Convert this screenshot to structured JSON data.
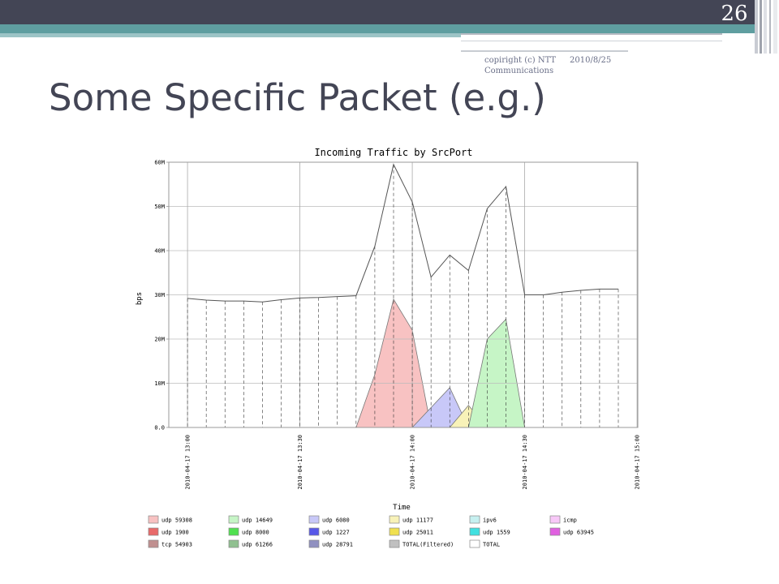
{
  "slide": {
    "number": "26",
    "title": "Some Specific Packet (e.g.)",
    "footer_left_1": "copiright (c) NTT",
    "footer_left_2": "Communications",
    "footer_right": "2010/8/25"
  },
  "colors": {
    "header": "#434555",
    "accent": "#5f9ea0"
  },
  "chart_data": {
    "type": "area",
    "title": "Incoming Traffic by SrcPort",
    "xlabel": "Time",
    "ylabel": "bps",
    "ylim": [
      0,
      60
    ],
    "xlim": [
      0,
      120
    ],
    "y_ticks": [
      {
        "v": 0,
        "label": "0.0"
      },
      {
        "v": 10,
        "label": "10M"
      },
      {
        "v": 20,
        "label": "20M"
      },
      {
        "v": 30,
        "label": "30M"
      },
      {
        "v": 40,
        "label": "40M"
      },
      {
        "v": 50,
        "label": "50M"
      },
      {
        "v": 60,
        "label": "60M"
      }
    ],
    "x_ticks": [
      {
        "v": 5,
        "label": "2010-04-17 13:00"
      },
      {
        "v": 35,
        "label": "2010-04-17 13:30"
      },
      {
        "v": 65,
        "label": "2010-04-17 14:00"
      },
      {
        "v": 95,
        "label": "2010-04-17 14:30"
      },
      {
        "v": 125,
        "label": "2010-04-17 15:00"
      }
    ],
    "sample_x": [
      5,
      10,
      15,
      20,
      25,
      30,
      35,
      40,
      45,
      50,
      55,
      60,
      65,
      70,
      75,
      80,
      85,
      90,
      95,
      100,
      105,
      110,
      115,
      120
    ],
    "total": [
      29.2,
      28.8,
      28.6,
      28.6,
      28.4,
      28.9,
      29.3,
      29.4,
      29.6,
      29.8,
      41,
      59.5,
      51,
      34,
      39,
      35.5,
      49.5,
      54.5,
      30,
      30,
      30.6,
      31,
      31.3,
      31.3
    ],
    "series": [
      {
        "name": "udp 59308",
        "color": "#f8c2c2",
        "x": [
          50,
          55,
          60,
          65,
          70
        ],
        "y": [
          0,
          12,
          29,
          22,
          0
        ]
      },
      {
        "name": "udp 1227",
        "color": "#c8c8f8",
        "x": [
          65,
          70,
          75,
          80
        ],
        "y": [
          0,
          4.5,
          9,
          0
        ]
      },
      {
        "name": "udp 11177",
        "color": "#f8f2b8",
        "x": [
          75,
          80,
          85
        ],
        "y": [
          0,
          5,
          0
        ]
      },
      {
        "name": "udp 14649",
        "color": "#c6f5c6",
        "x": [
          80,
          85,
          90,
          95
        ],
        "y": [
          0,
          20,
          24.5,
          0
        ]
      }
    ],
    "legend": [
      {
        "name": "udp 59308",
        "color": "#f8c2c2"
      },
      {
        "name": "udp 14649",
        "color": "#c6f5c6"
      },
      {
        "name": "udp 6080",
        "color": "#c8c8f8"
      },
      {
        "name": "udp 11177",
        "color": "#f8f2b8"
      },
      {
        "name": "ipv6",
        "color": "#c6f0f0"
      },
      {
        "name": "icmp",
        "color": "#f8c8f8"
      },
      {
        "name": "udp 1900",
        "color": "#e86a6a"
      },
      {
        "name": "udp 8000",
        "color": "#50e050"
      },
      {
        "name": "udp 1227",
        "color": "#5858e8"
      },
      {
        "name": "udp 25011",
        "color": "#f0e050"
      },
      {
        "name": "udp 1559",
        "color": "#40e0e0"
      },
      {
        "name": "udp 63945",
        "color": "#e060e0"
      },
      {
        "name": "tcp 54903",
        "color": "#c09090"
      },
      {
        "name": "udp 61266",
        "color": "#90c090"
      },
      {
        "name": "udp 28791",
        "color": "#9090c0"
      },
      {
        "name": "TOTAL(Filtered)",
        "color": "#c0c0c0"
      },
      {
        "name": "TOTAL",
        "color": "#ffffff"
      }
    ]
  }
}
